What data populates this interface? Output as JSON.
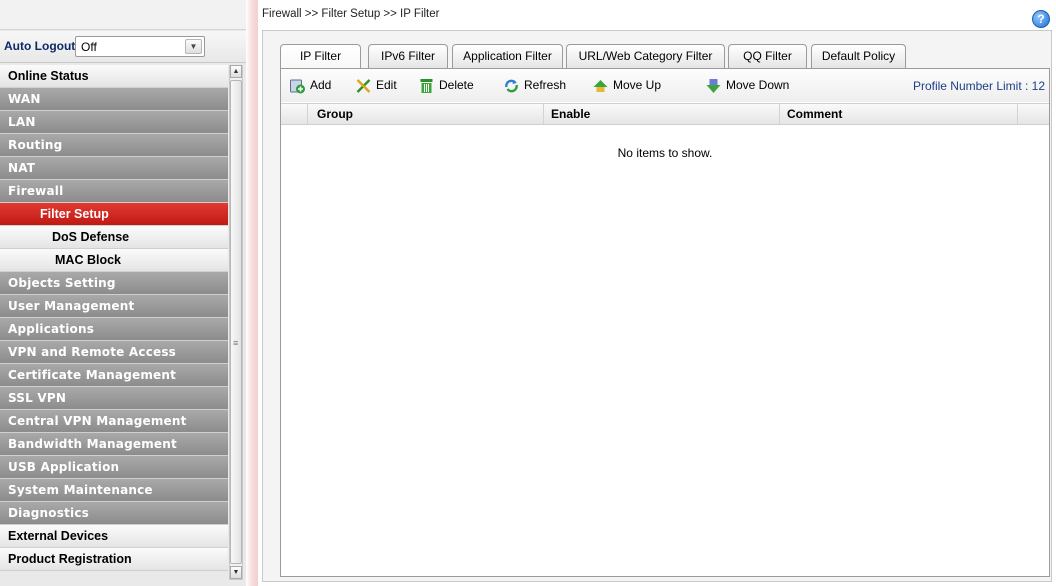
{
  "sidebar": {
    "auto_logout_label": "Auto Logout :",
    "auto_logout_value": "Off",
    "menu": [
      {
        "label": "Online Status",
        "style": "light"
      },
      {
        "label": "WAN",
        "style": "dark"
      },
      {
        "label": "LAN",
        "style": "dark"
      },
      {
        "label": "Routing",
        "style": "dark"
      },
      {
        "label": "NAT",
        "style": "dark"
      },
      {
        "label": "Firewall",
        "style": "dark"
      },
      {
        "label": "Filter Setup",
        "style": "active"
      },
      {
        "label": "DoS Defense",
        "style": "sub"
      },
      {
        "label": "MAC Block",
        "style": "sub"
      },
      {
        "label": "Objects Setting",
        "style": "dark"
      },
      {
        "label": "User Management",
        "style": "dark"
      },
      {
        "label": "Applications",
        "style": "dark"
      },
      {
        "label": "VPN and Remote Access",
        "style": "dark"
      },
      {
        "label": "Certificate Management",
        "style": "dark"
      },
      {
        "label": "SSL VPN",
        "style": "dark"
      },
      {
        "label": "Central VPN Management",
        "style": "dark"
      },
      {
        "label": "Bandwidth Management",
        "style": "dark"
      },
      {
        "label": "USB Application",
        "style": "dark"
      },
      {
        "label": "System Maintenance",
        "style": "dark"
      },
      {
        "label": "Diagnostics",
        "style": "dark"
      },
      {
        "label": "External Devices",
        "style": "light"
      },
      {
        "label": "Product Registration",
        "style": "light"
      }
    ]
  },
  "header": {
    "breadcrumb": "Firewall >> Filter Setup >> IP Filter",
    "help_icon": "?"
  },
  "tabs": [
    {
      "label": "IP Filter",
      "active": true
    },
    {
      "label": "IPv6 Filter",
      "active": false
    },
    {
      "label": "Application Filter",
      "active": false
    },
    {
      "label": "URL/Web Category Filter",
      "active": false
    },
    {
      "label": "QQ Filter",
      "active": false
    },
    {
      "label": "Default Policy",
      "active": false
    }
  ],
  "toolbar": {
    "add": "Add",
    "edit": "Edit",
    "delete": "Delete",
    "refresh": "Refresh",
    "move_up": "Move Up",
    "move_down": "Move Down",
    "profile_limit": "Profile Number Limit : 12"
  },
  "table": {
    "columns": [
      "Group",
      "Enable",
      "Comment"
    ],
    "empty_message": "No items to show."
  },
  "colors": {
    "active_menu": "#d12a23",
    "dark_menu": "#9a9a9a",
    "profile_limit_text": "#1c3f86"
  }
}
